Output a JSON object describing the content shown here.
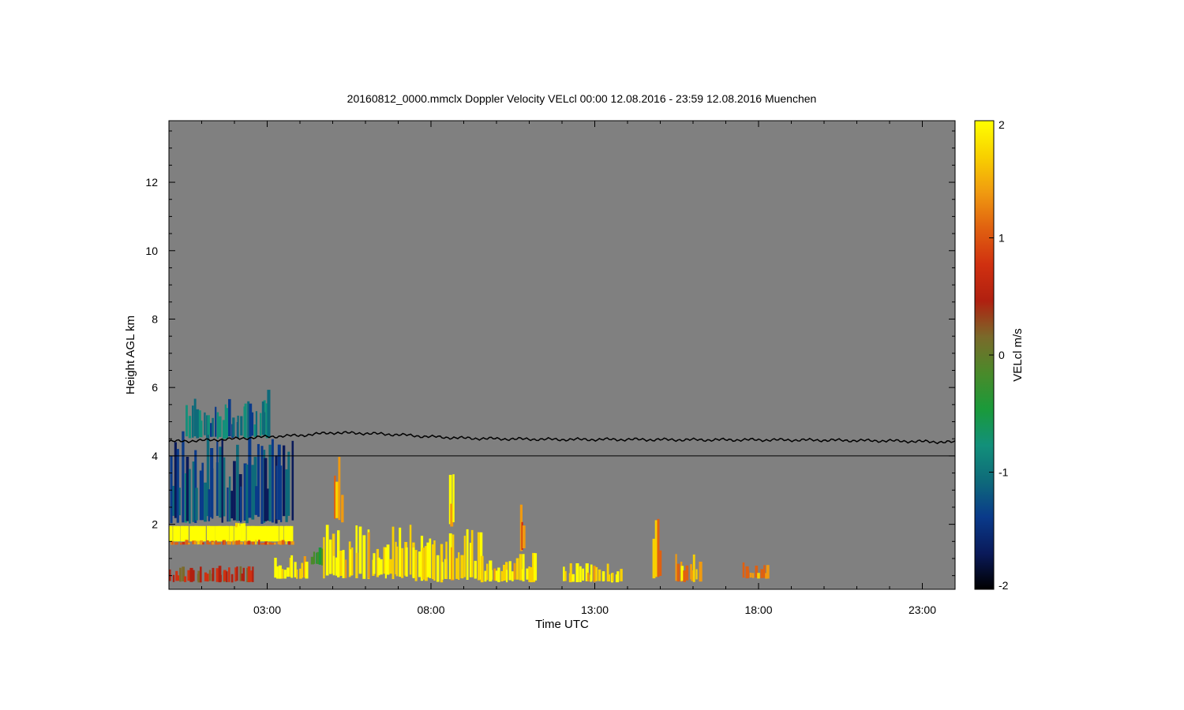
{
  "title": "20160812_0000.mmclx Doppler Velocity VELcl   00:00 12.08.2016 - 23:59 12.08.2016 Muenchen",
  "chart_data": {
    "type": "heatmap",
    "title": "20160812_0000.mmclx Doppler Velocity VELcl   00:00 12.08.2016 - 23:59 12.08.2016 Muenchen",
    "xlabel": "Time UTC",
    "ylabel": "Height AGL km",
    "x_range_hours": [
      0,
      24
    ],
    "y_range_km": [
      0.1,
      13.8
    ],
    "x_tick_labels": [
      "03:00",
      "08:00",
      "13:00",
      "18:00",
      "23:00"
    ],
    "x_tick_hours": [
      3,
      8,
      13,
      18,
      23
    ],
    "y_tick_values": [
      2,
      4,
      6,
      8,
      10,
      12
    ],
    "y_tick_labels": [
      "2",
      "4",
      "6",
      "8",
      "10",
      "12"
    ],
    "background_color": "#808080",
    "reference_line_km": 4.0,
    "freezing_level_line": {
      "color": "#000000",
      "points": [
        [
          0,
          4.42
        ],
        [
          1,
          4.45
        ],
        [
          2,
          4.5
        ],
        [
          3,
          4.56
        ],
        [
          4,
          4.6
        ],
        [
          5,
          4.68
        ],
        [
          6,
          4.66
        ],
        [
          7,
          4.62
        ],
        [
          8,
          4.56
        ],
        [
          9,
          4.52
        ],
        [
          10,
          4.5
        ],
        [
          12,
          4.48
        ],
        [
          14,
          4.48
        ],
        [
          16,
          4.47
        ],
        [
          18,
          4.47
        ],
        [
          20,
          4.46
        ],
        [
          22,
          4.44
        ],
        [
          24,
          4.4
        ]
      ]
    },
    "colorbar": {
      "label": "VELcl m/s",
      "range": [
        -2,
        2
      ],
      "tick_values": [
        -2,
        -1,
        0,
        1,
        2
      ],
      "tick_labels": [
        "-2",
        "-1",
        "0",
        "1",
        "2"
      ],
      "colors": [
        "#000000",
        "#0a1a5a",
        "#0a3a8a",
        "#0e6a7a",
        "#12907a",
        "#1a9a3a",
        "#4a8a2a",
        "#7a6a2a",
        "#b02010",
        "#d03010",
        "#e06010",
        "#f09a10",
        "#f8d000",
        "#ffff00"
      ]
    },
    "echo_regions": [
      {
        "t0": 0.0,
        "t1": 3.75,
        "h0": 2.0,
        "h1": 4.8,
        "velocity": -1.3
      },
      {
        "t0": 0.5,
        "t1": 3.0,
        "h0": 4.5,
        "h1": 5.7,
        "velocity": -1.0
      },
      {
        "t0": 2.8,
        "t1": 3.0,
        "h0": 4.5,
        "h1": 6.4,
        "velocity": -0.8
      },
      {
        "t0": 0.0,
        "t1": 3.75,
        "h0": 1.5,
        "h1": 1.95,
        "velocity": 2.0
      },
      {
        "t0": 2.0,
        "t1": 2.3,
        "h0": 1.9,
        "h1": 2.05,
        "velocity": 2.0
      },
      {
        "t0": 0.0,
        "t1": 3.75,
        "h0": 1.4,
        "h1": 1.55,
        "velocity": 1.2
      },
      {
        "t0": 0.0,
        "t1": 2.6,
        "h0": 0.3,
        "h1": 0.8,
        "velocity": 0.4
      },
      {
        "t0": 3.2,
        "t1": 4.2,
        "h0": 0.4,
        "h1": 1.1,
        "velocity": 1.9
      },
      {
        "t0": 4.3,
        "t1": 4.7,
        "h0": 0.8,
        "h1": 1.4,
        "velocity": -0.5
      },
      {
        "t0": 4.7,
        "t1": 7.5,
        "h0": 0.4,
        "h1": 2.0,
        "velocity": 1.9
      },
      {
        "t0": 5.0,
        "t1": 5.3,
        "h0": 2.0,
        "h1": 4.0,
        "velocity": 1.5
      },
      {
        "t0": 7.5,
        "t1": 9.5,
        "h0": 0.3,
        "h1": 1.9,
        "velocity": 1.9
      },
      {
        "t0": 8.5,
        "t1": 8.7,
        "h0": 1.9,
        "h1": 3.9,
        "velocity": 1.7
      },
      {
        "t0": 9.5,
        "t1": 11.2,
        "h0": 0.3,
        "h1": 1.2,
        "velocity": 1.8
      },
      {
        "t0": 10.7,
        "t1": 10.8,
        "h0": 1.2,
        "h1": 2.8,
        "velocity": 1.0
      },
      {
        "t0": 12.0,
        "t1": 13.8,
        "h0": 0.3,
        "h1": 0.9,
        "velocity": 1.9
      },
      {
        "t0": 14.7,
        "t1": 15.0,
        "h0": 0.3,
        "h1": 2.4,
        "velocity": 1.5
      },
      {
        "t0": 15.4,
        "t1": 16.2,
        "h0": 0.3,
        "h1": 1.3,
        "velocity": 1.5
      },
      {
        "t0": 17.5,
        "t1": 18.3,
        "h0": 0.4,
        "h1": 0.9,
        "velocity": 1.3
      }
    ]
  }
}
